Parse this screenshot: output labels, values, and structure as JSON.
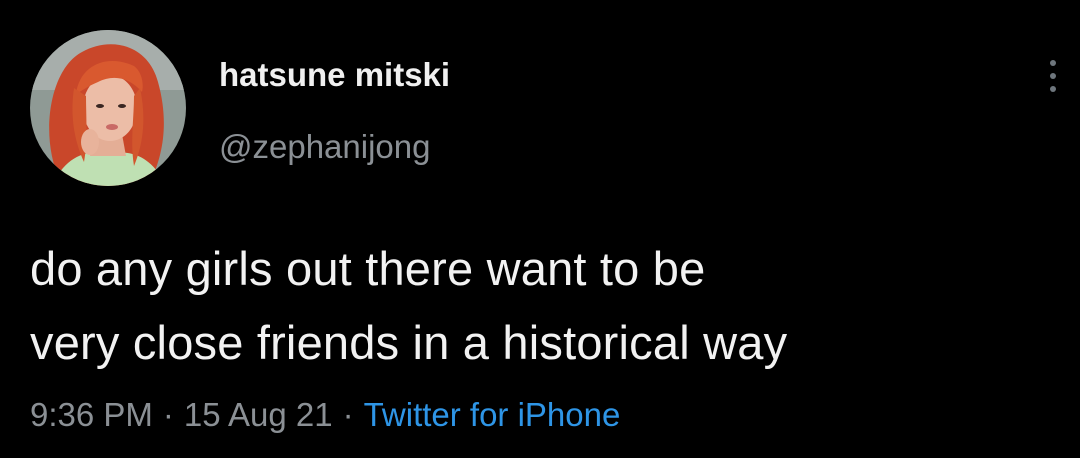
{
  "tweet": {
    "display_name": "hatsune mitski",
    "handle": "@zephanijong",
    "avatar": {
      "icon": "profile-photo",
      "colors": {
        "background": "#8f9a95",
        "hair": "#d2562d",
        "skin": "#e9b7a0",
        "top": "#bfe0b3"
      }
    },
    "more_icon": "more-options-icon",
    "text_lines": [
      "do any girls out there want to be",
      "very close friends in a historical way"
    ],
    "time": "9:36 PM",
    "separator": "·",
    "date": "15 Aug 21",
    "source": "Twitter for iPhone"
  },
  "colors": {
    "background": "#000000",
    "text": "#e7e9ea",
    "secondary": "#8b9095",
    "link": "#1d9bf0"
  }
}
